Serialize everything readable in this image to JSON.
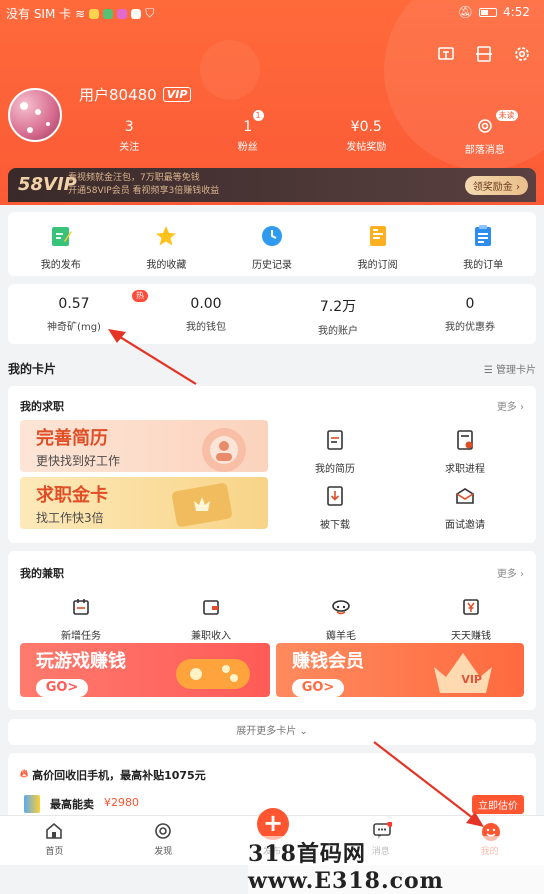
{
  "status_bar": {
    "carrier": "没有 SIM 卡",
    "time": "4:52"
  },
  "user": {
    "name": "用户80480",
    "vip_label": "VIP"
  },
  "stats": [
    {
      "num": "3",
      "label": "关注"
    },
    {
      "num": "1",
      "label": "粉丝",
      "badge": "1"
    },
    {
      "num": "¥0.5",
      "label": "发帖奖励"
    },
    {
      "num": "",
      "label": "部落消息",
      "badge": "未读"
    }
  ],
  "vip_bar": {
    "logo": "58VIP",
    "line1": "看视频就金汪包，7万职最等免钱",
    "line2": "开通58VIP会员  看视频享3倍赚钱收益",
    "button": "领奖励金 ›"
  },
  "quick": [
    {
      "label": "我的发布",
      "icon": "publish-icon"
    },
    {
      "label": "我的收藏",
      "icon": "star-icon"
    },
    {
      "label": "历史记录",
      "icon": "clock-icon"
    },
    {
      "label": "我的订阅",
      "icon": "subscribe-icon"
    },
    {
      "label": "我的订单",
      "icon": "order-icon"
    }
  ],
  "accounts": [
    {
      "num": "0.57",
      "label": "神奇矿(mg)",
      "badge": "热"
    },
    {
      "num": "0.00",
      "label": "我的钱包"
    },
    {
      "num": "7.2万",
      "label": "我的账户"
    },
    {
      "num": "0",
      "label": "我的优惠券"
    }
  ],
  "cards_title": "我的卡片",
  "manage_label": "☰ 管理卡片",
  "job": {
    "title": "我的求职",
    "more": "更多 ›",
    "banner1": {
      "t1": "完善简历",
      "t2": "更快找到好工作"
    },
    "banner2": {
      "t1": "求职金卡",
      "t2": "找工作快3倍"
    },
    "items": [
      "我的简历",
      "求职进程",
      "被下载",
      "面试邀请"
    ]
  },
  "parttime": {
    "title": "我的兼职",
    "more": "更多 ›",
    "items": [
      "新增任务",
      "兼职收入",
      "薅羊毛",
      "天天赚钱"
    ],
    "banner1": {
      "t1": "玩游戏赚钱",
      "go": "GO>"
    },
    "banner2": {
      "t1": "赚钱会员",
      "go": "GO>",
      "tag": "VIP"
    }
  },
  "expand_label": "展开更多卡片 ⌄",
  "promo": {
    "title": "高价回收旧手机，最高补贴1075元",
    "item": "最高能卖",
    "price": "¥2980",
    "button": "立即估价"
  },
  "tabs": [
    {
      "label": "首页",
      "icon": "home-icon"
    },
    {
      "label": "发现",
      "icon": "discover-icon"
    },
    {
      "label": "发布",
      "icon": "plus-icon"
    },
    {
      "label": "消息",
      "icon": "message-icon"
    },
    {
      "label": "我的",
      "icon": "profile-icon"
    }
  ],
  "fab": "+",
  "watermark": "318首码网 www.E318.com",
  "colors": {
    "primary": "#fb5a35",
    "vip_gold": "#e9c9a3",
    "hot_red": "#ff4b3a"
  }
}
